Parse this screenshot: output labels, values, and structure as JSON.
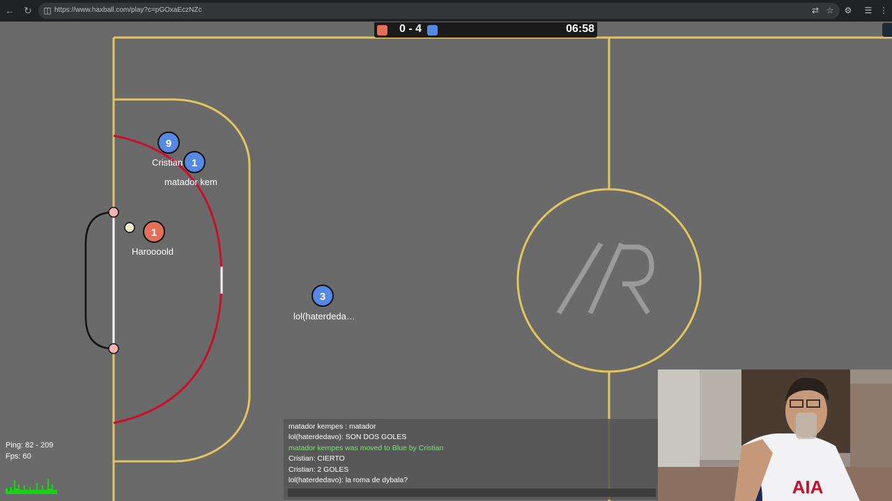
{
  "browser": {
    "url": "https://www.haxball.com/play?c=pGOxaEczNZc",
    "icons": [
      "back-icon",
      "reload-icon",
      "site-info-icon",
      "translate-icon",
      "bookmark-star-icon",
      "extensions-icon",
      "settings-icon",
      "profile-icon"
    ]
  },
  "scoreboard": {
    "red_color": "#e56e56",
    "blue_color": "#5689e5",
    "score": "0 - 4",
    "time": "06:58"
  },
  "field": {
    "line_color": "#e3c65e",
    "area_color": "#c8102e",
    "center_logo": "/R"
  },
  "players": [
    {
      "number": "9",
      "team": "blue",
      "name": "Cristian"
    },
    {
      "number": "1",
      "team": "blue",
      "name": "matador  kem"
    },
    {
      "number": "1",
      "team": "red",
      "name": "Haroooold"
    },
    {
      "number": "3",
      "team": "blue",
      "name": "lol(haterdeda…"
    }
  ],
  "stats": {
    "ping": "Ping: 82 - 209",
    "fps": "Fps: 60"
  },
  "chat": {
    "messages": [
      {
        "text": "matador kempes : matador",
        "color": "#ffffff"
      },
      {
        "text": "lol(haterdedavo): SON DOS GOLES",
        "color": "#ffffff"
      },
      {
        "text": "matador kempes was moved to Blue by Cristian",
        "color": "#7ee37e"
      },
      {
        "text": "Cristian: CIERTO",
        "color": "#ffffff"
      },
      {
        "text": "Cristian: 2 GOLES",
        "color": "#ffffff"
      },
      {
        "text": "lol(haterdedavo): la roma de dybala?",
        "color": "#ffffff"
      }
    ],
    "input_value": ""
  },
  "webcam": {
    "jersey_text": "AIA"
  }
}
